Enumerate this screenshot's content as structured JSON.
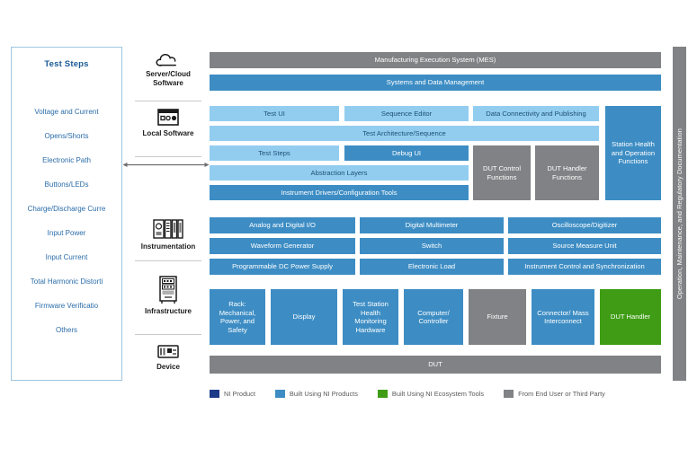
{
  "test_steps_panel": {
    "title": "Test Steps",
    "items": [
      "Voltage and Current",
      "Opens/Shorts",
      "Electronic Path",
      "Buttons/LEDs",
      "Charge/Discharge Curre",
      "Input Power",
      "Input Current",
      "Total Harmonic Distorti",
      "Firmware Verificatio",
      "Others"
    ]
  },
  "layers": [
    {
      "icon": "cloud-icon",
      "label": "Server/Cloud\nSoftware",
      "label_line1": "Server/Cloud",
      "label_line2": "Software"
    },
    {
      "icon": "application-window-icon",
      "label": "Local Software",
      "label_line1": "Local Software",
      "label_line2": ""
    },
    {
      "icon": "instrument-modules-icon",
      "label": "Instrumentation",
      "label_line1": "Instrumentation",
      "label_line2": ""
    },
    {
      "icon": "server-rack-icon",
      "label": "Infrastructure",
      "label_line1": "Infrastructure",
      "label_line2": ""
    },
    {
      "icon": "circuit-board-icon",
      "label": "Device",
      "label_line1": "Device",
      "label_line2": ""
    }
  ],
  "server_cloud": {
    "mes": "Manufacturing Execution System (MES)",
    "systems_data": "Systems and Data Management"
  },
  "local_software": {
    "test_ui": "Test UI",
    "sequence_editor": "Sequence Editor",
    "data_connectivity": "Data Connectivity and Publishing",
    "test_architecture": "Test Architecture/Sequence",
    "test_steps": "Test Steps",
    "debug_ui": "Debug UI",
    "abstraction_layers": "Abstraction Layers",
    "instrument_drivers": "Instrument Drivers/Configuration Tools",
    "dut_control": "DUT Control Functions",
    "dut_handler": "DUT Handler Functions",
    "station_health": "Station Health and Operation Functions"
  },
  "instrumentation": {
    "analog_digital_io": "Analog and Digital I/O",
    "digital_multimeter": "Digital Multimeter",
    "oscilloscope": "Oscilloscope/Digitizer",
    "waveform_generator": "Waveform Generator",
    "switch": "Switch",
    "source_measure_unit": "Source Measure Unit",
    "dc_power_supply": "Programmable DC Power Supply",
    "electronic_load": "Electronic Load",
    "instrument_control": "Instrument Control and Synchronization"
  },
  "infrastructure": {
    "rack": "Rack: Mechanical, Power, and Safety",
    "display": "Display",
    "test_station_health": "Test Station Health Monitoring Hardware",
    "computer": "Computer/ Controller",
    "fixture": "Fixture",
    "connector": "Connector/ Mass Interconnect",
    "dut_handler": "DUT Handler"
  },
  "device": {
    "dut": "DUT"
  },
  "vertical_bar": {
    "label": "Operation, Maintenance, and Regulatory Documentation"
  },
  "legend": [
    {
      "label": "NI Product",
      "color": "#1b3a87"
    },
    {
      "label": "Built Using NI Products",
      "color": "#3d8dc4"
    },
    {
      "label": "Built Using NI Ecosystem Tools",
      "color": "#3f9c14"
    },
    {
      "label": "From End User or Third Party",
      "color": "#808285"
    }
  ],
  "colors": {
    "gray": "#808285",
    "medium_blue": "#3d8dc4",
    "light_blue": "#92cdf0",
    "green": "#3f9c14",
    "navy": "#1b3a87",
    "panel_border": "#9ec6e0",
    "panel_text": "#2a6ca8"
  }
}
